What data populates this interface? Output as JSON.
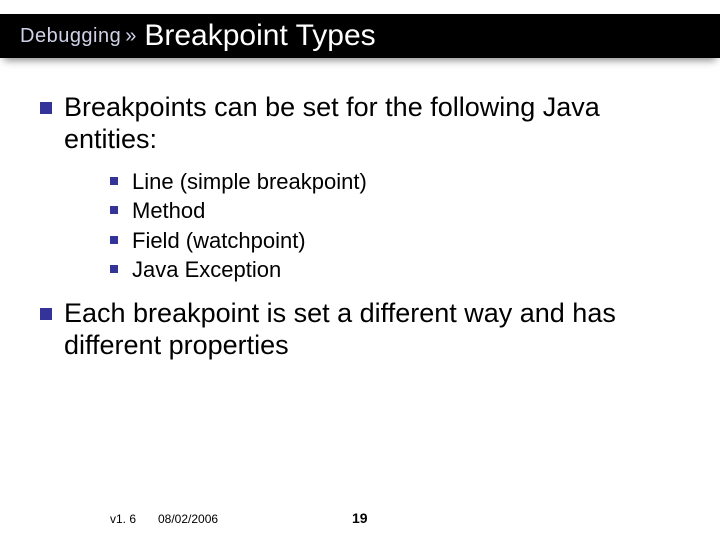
{
  "header": {
    "breadcrumb": "Debugging",
    "separator": "»",
    "title": "Breakpoint Types"
  },
  "bullets": [
    {
      "text": "Breakpoints can be set for the following Java entities:",
      "sub": [
        "Line  (simple breakpoint)",
        "Method",
        "Field (watchpoint)",
        "Java Exception"
      ]
    },
    {
      "text": "Each breakpoint is set a different way and has different properties",
      "sub": []
    }
  ],
  "footer": {
    "version": "v1. 6",
    "date": "08/02/2006",
    "page": "19"
  }
}
